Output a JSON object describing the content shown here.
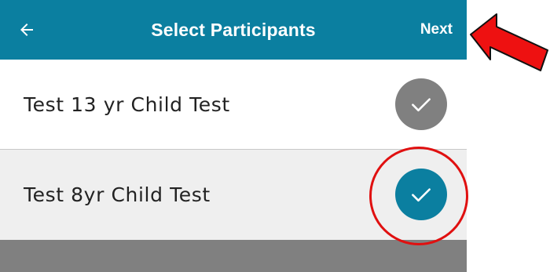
{
  "header": {
    "title": "Select Participants",
    "next_label": "Next",
    "back_icon": "arrow-left-icon",
    "background": "#0b7fa0"
  },
  "participants": [
    {
      "name": "Test 13 yr Child Test",
      "selected": false,
      "check_color": "#808080"
    },
    {
      "name": "Test 8yr Child Test",
      "selected": true,
      "check_color": "#0b7fa0"
    }
  ],
  "annotations": {
    "highlight_color": "#e01010",
    "arrow_fill": "#ee1111"
  }
}
